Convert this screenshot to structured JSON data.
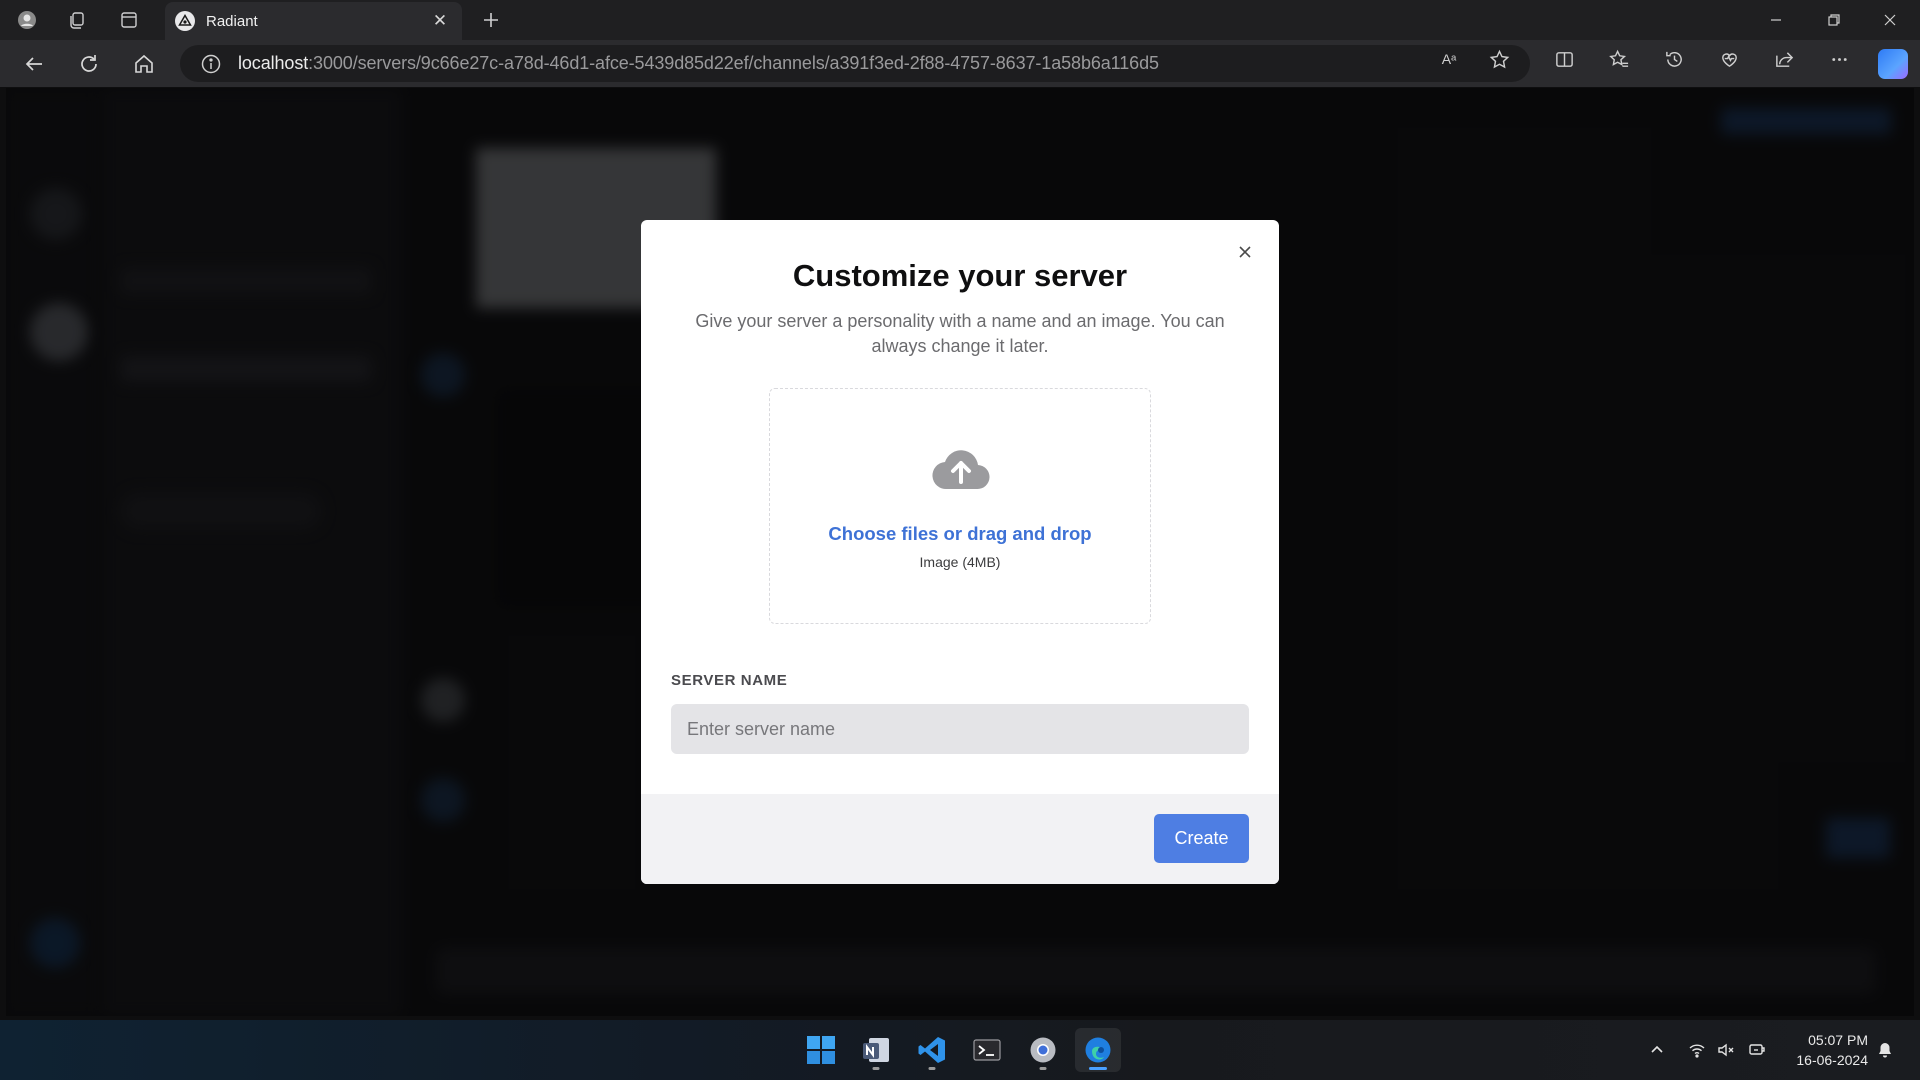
{
  "browser": {
    "tab_title": "Radiant",
    "url_host": "localhost",
    "url_path": ":3000/servers/9c66e27c-a78d-46d1-afce-5439d85d22ef/channels/a391f3ed-2f88-4757-8637-1a58b6a116d5",
    "read_aloud_glyph": "Aᵃ"
  },
  "modal": {
    "title": "Customize your server",
    "description": "Give your server a personality with a name and an image. You can always change it later.",
    "upload": {
      "label": "Choose files or drag and drop",
      "hint": "Image (4MB)"
    },
    "server_name": {
      "label": "SERVER NAME",
      "placeholder": "Enter server name",
      "value": ""
    },
    "create_label": "Create"
  },
  "colors": {
    "accent": "#4e7ee3",
    "link": "#3e72d6",
    "overlay": "#000000"
  },
  "taskbar": {
    "apps": [
      "windows-start",
      "onenote",
      "vscode",
      "terminal",
      "chrome",
      "edge"
    ],
    "time": "05:07 PM",
    "date": "16-06-2024"
  }
}
